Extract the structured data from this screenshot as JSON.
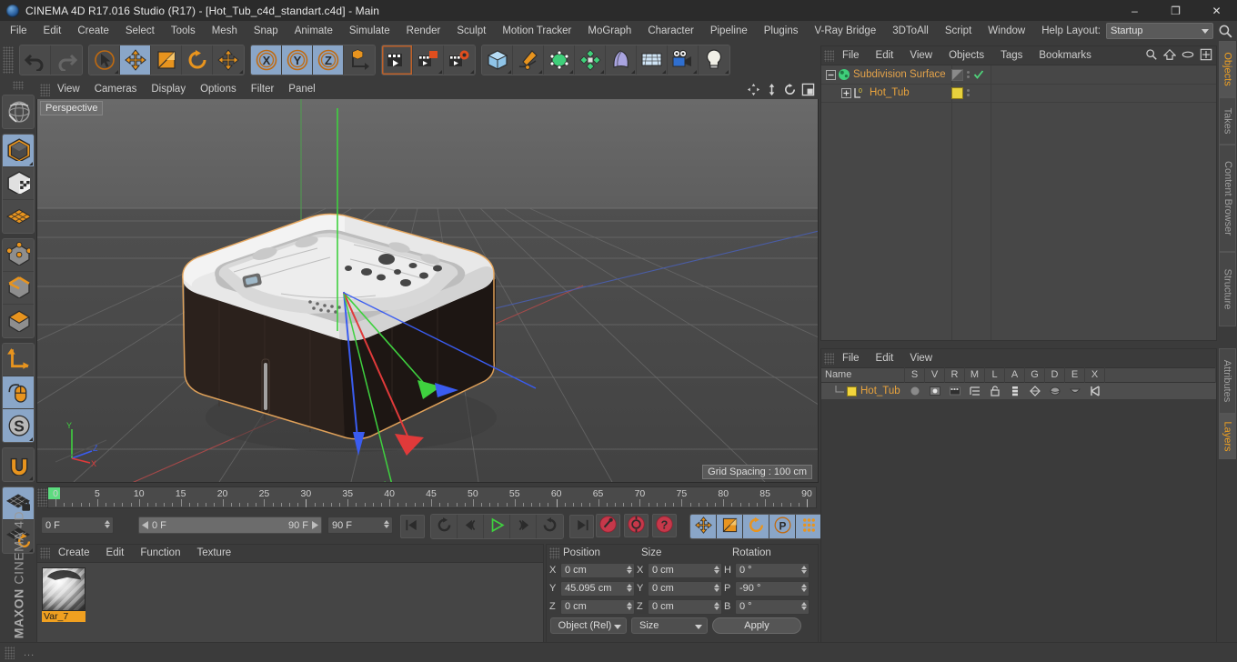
{
  "window": {
    "title": "CINEMA 4D R17.016 Studio (R17) - [Hot_Tub_c4d_standart.c4d] - Main",
    "minimize": "–",
    "maximize": "❐",
    "close": "✕"
  },
  "menubar": {
    "items": [
      "File",
      "Edit",
      "Create",
      "Select",
      "Tools",
      "Mesh",
      "Snap",
      "Animate",
      "Simulate",
      "Render",
      "Sculpt",
      "Motion Tracker",
      "MoGraph",
      "Character",
      "Pipeline",
      "Plugins",
      "V-Ray Bridge",
      "3DToAll",
      "Script",
      "Window",
      "Help"
    ],
    "layout_label": "Layout:",
    "layout_value": "Startup"
  },
  "toolbar": {
    "groups": [
      {
        "name": "history",
        "buttons": [
          {
            "name": "undo-button",
            "icon": "undo-icon",
            "active": false,
            "dim": false
          },
          {
            "name": "redo-button",
            "icon": "redo-icon",
            "active": false,
            "dim": true
          }
        ]
      },
      {
        "name": "transform",
        "buttons": [
          {
            "name": "live-selection-button",
            "icon": "cursor-select-icon",
            "active": false,
            "corner": true
          },
          {
            "name": "move-tool-button",
            "icon": "move-icon",
            "active": true
          },
          {
            "name": "scale-tool-button",
            "icon": "scale-icon",
            "active": false
          },
          {
            "name": "rotate-tool-button",
            "icon": "rotate-icon",
            "active": false
          },
          {
            "name": "move-alt-button",
            "icon": "move-icon",
            "active": false,
            "corner": true
          }
        ]
      },
      {
        "name": "axis-locks",
        "buttons": [
          {
            "name": "lock-x-button",
            "icon": "axis-x-icon",
            "active": true
          },
          {
            "name": "lock-y-button",
            "icon": "axis-y-icon",
            "active": true
          },
          {
            "name": "lock-z-button",
            "icon": "axis-z-icon",
            "active": true
          },
          {
            "name": "world-coordinates-button",
            "icon": "world-axis-icon",
            "active": false
          }
        ]
      },
      {
        "name": "render",
        "buttons": [
          {
            "name": "render-view-button",
            "icon": "render-view-icon",
            "active": false,
            "sel": true
          },
          {
            "name": "render-to-picture-viewer-button",
            "icon": "render-picture-icon",
            "active": false,
            "corner": true
          },
          {
            "name": "render-settings-button",
            "icon": "render-settings-icon",
            "active": false,
            "corner": true
          }
        ]
      },
      {
        "name": "objects",
        "buttons": [
          {
            "name": "add-cube-button",
            "icon": "cube-icon",
            "active": false,
            "corner": true
          },
          {
            "name": "add-spline-button",
            "icon": "pen-spline-icon",
            "active": false,
            "corner": true
          },
          {
            "name": "add-generator-button",
            "icon": "nurbs-icon",
            "active": false,
            "corner": true
          },
          {
            "name": "add-deformer-button",
            "icon": "deformer-icon",
            "active": false,
            "corner": true
          },
          {
            "name": "add-scene-button",
            "icon": "bend-icon",
            "active": false,
            "corner": true
          },
          {
            "name": "add-floor-button",
            "icon": "floor-grid-icon",
            "active": false,
            "corner": true
          },
          {
            "name": "add-camera-button",
            "icon": "camera-icon",
            "active": false,
            "corner": true
          },
          {
            "name": "add-light-button",
            "icon": "light-bulb-icon",
            "active": false,
            "corner": true
          }
        ]
      }
    ]
  },
  "lefttoolbar": {
    "groups": [
      [
        {
          "name": "make-editable-button",
          "icon": "globe-editable-icon",
          "active": false
        }
      ],
      [
        {
          "name": "model-mode-button",
          "icon": "model-cube-icon",
          "active": true,
          "corner": true
        },
        {
          "name": "texture-mode-button",
          "icon": "texture-cube-icon",
          "active": false
        },
        {
          "name": "workplane-button",
          "icon": "grid-plane-icon",
          "active": false
        }
      ],
      [
        {
          "name": "points-mode-button",
          "icon": "points-icon",
          "active": false
        },
        {
          "name": "edges-mode-button",
          "icon": "edges-icon",
          "active": false
        },
        {
          "name": "polygons-mode-button",
          "icon": "polygons-icon",
          "active": false
        }
      ],
      [
        {
          "name": "axis-mode-button",
          "icon": "axis-l-icon",
          "active": false
        },
        {
          "name": "viewport-solo-button",
          "icon": "mouse-icon",
          "active": true
        },
        {
          "name": "snap-button",
          "icon": "snap-s-icon",
          "active": true,
          "corner": true
        }
      ],
      [
        {
          "name": "magnet-button",
          "icon": "magnet-icon",
          "active": false,
          "corner": true
        }
      ],
      [
        {
          "name": "workplane-lock-button",
          "icon": "plane-lock-icon",
          "active": true
        },
        {
          "name": "workplane-rotate-button",
          "icon": "plane-rotate-icon",
          "active": false,
          "corner": true
        }
      ]
    ],
    "brand_bold": "MAXON",
    "brand_thin": "CINEMA 4D"
  },
  "viewport": {
    "menu": [
      "View",
      "Cameras",
      "Display",
      "Options",
      "Filter",
      "Panel"
    ],
    "nav_icons": [
      "pan-icon",
      "zoom-icon",
      "rotate-view-icon",
      "maximize-view-icon"
    ],
    "label": "Perspective",
    "grid_spacing": "Grid Spacing : 100 cm",
    "axis": {
      "x": "X",
      "y": "Y",
      "z": "Z"
    },
    "model_name": "Hot_Tub"
  },
  "timeline": {
    "ticks": [
      0,
      5,
      10,
      15,
      20,
      25,
      30,
      35,
      40,
      45,
      50,
      55,
      60,
      65,
      70,
      75,
      80,
      85,
      90
    ],
    "start": 0,
    "end": 90,
    "current_frame_field": "0 F",
    "range_start": "0 F",
    "range_end": "90 F",
    "max_frame_field": "90 F",
    "end_field": "0 F",
    "transport": [
      {
        "name": "go-to-start-button",
        "icon": "skip-start-icon"
      },
      {
        "name": "play-backward-loop-button",
        "icon": "loop-icon"
      },
      {
        "name": "step-back-button",
        "icon": "step-back-icon"
      },
      {
        "name": "play-button",
        "icon": "play-icon"
      },
      {
        "name": "step-forward-button",
        "icon": "step-forward-icon"
      },
      {
        "name": "loop-forward-button",
        "icon": "loop-forward-icon"
      },
      {
        "name": "go-to-end-button",
        "icon": "skip-end-icon"
      }
    ],
    "record": [
      {
        "name": "record-keyframe-button",
        "icon": "record-key-icon"
      },
      {
        "name": "autokey-button",
        "icon": "autokey-icon"
      },
      {
        "name": "keyframe-help-button",
        "icon": "question-icon"
      }
    ],
    "keyflags": [
      {
        "name": "key-position-button",
        "icon": "move-icon",
        "active": true
      },
      {
        "name": "key-scale-button",
        "icon": "scale-icon",
        "active": true
      },
      {
        "name": "key-rotation-button",
        "icon": "rotate-icon",
        "active": true
      },
      {
        "name": "key-parameter-button",
        "icon": "param-p-icon",
        "active": true
      },
      {
        "name": "key-point-level-button",
        "icon": "pla-dots-icon",
        "active": true
      }
    ],
    "filmstrip": {
      "name": "timeline-view-button",
      "icon": "filmstrip-icon"
    }
  },
  "materials": {
    "menu": [
      "Create",
      "Edit",
      "Function",
      "Texture"
    ],
    "items": [
      {
        "name": "Var_7",
        "selected": true
      }
    ]
  },
  "coordinates": {
    "headers": [
      "Position",
      "Size",
      "Rotation"
    ],
    "position": {
      "labels": [
        "X",
        "Y",
        "Z"
      ],
      "values": [
        "0 cm",
        "45.095 cm",
        "0 cm"
      ]
    },
    "size": {
      "labels": [
        "X",
        "Y",
        "Z"
      ],
      "values": [
        "0 cm",
        "0 cm",
        "0 cm"
      ]
    },
    "rotation": {
      "labels": [
        "H",
        "P",
        "B"
      ],
      "values": [
        "0 °",
        "-90 °",
        "0 °"
      ]
    },
    "mode_dropdown": "Object (Rel)",
    "size_dropdown": "Size",
    "apply_button": "Apply"
  },
  "objectmanager": {
    "menu": [
      "File",
      "Edit",
      "View",
      "Objects",
      "Tags",
      "Bookmarks"
    ],
    "header_icons": [
      "search-icon",
      "home-icon",
      "eye-icon",
      "fullscreen-icon"
    ],
    "rows": [
      {
        "name": "Subdivision Surface",
        "depth": 0,
        "color": "#e3a24a",
        "tag": "subdivision",
        "checked": true
      },
      {
        "name": "Hot_Tub",
        "depth": 1,
        "color": "#e8a33d",
        "tag": "yellow",
        "checked": false
      }
    ]
  },
  "layermanager": {
    "menu": [
      "File",
      "Edit",
      "View"
    ],
    "columns": [
      "Name",
      "S",
      "V",
      "R",
      "M",
      "L",
      "A",
      "G",
      "D",
      "E",
      "X"
    ],
    "rows": [
      {
        "name": "Hot_Tub",
        "color": "#f2d53c"
      }
    ]
  },
  "vtabs": {
    "right_top": [
      {
        "label": "Objects",
        "active": true
      },
      {
        "label": "Takes",
        "active": false
      },
      {
        "label": "Content Browser",
        "active": false
      },
      {
        "label": "Structure",
        "active": false
      }
    ],
    "right_bottom": [
      {
        "label": "Attributes",
        "active": false
      },
      {
        "label": "Layers",
        "active": true
      }
    ]
  },
  "status": {
    "text": "..."
  }
}
